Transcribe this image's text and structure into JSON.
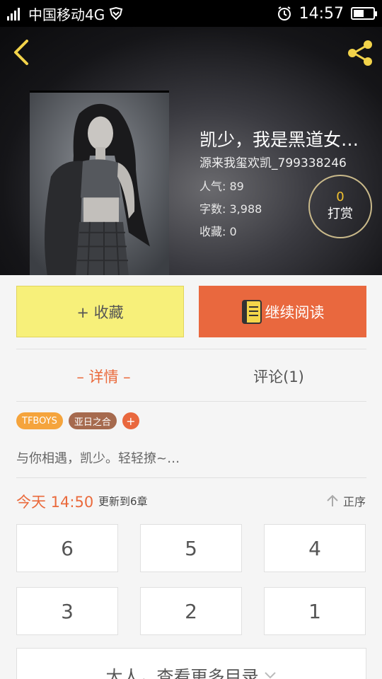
{
  "status_bar": {
    "network": "中国移动4G",
    "time": "14:57"
  },
  "book": {
    "title": "凯少，我是黑道女…",
    "author": "源来我玺欢凯_799338246",
    "popularity_label": "人气:",
    "popularity": "89",
    "word_count_label": "字数:",
    "word_count": "3,988",
    "favorites_label": "收藏:",
    "favorites": "0",
    "reward_count": "0",
    "reward_label": "打赏"
  },
  "actions": {
    "favorite_label": "+ 收藏",
    "continue_label": "继续阅读"
  },
  "tabs": {
    "details": "– 详情 –",
    "comments": "评论(1)"
  },
  "tags": [
    "TFBOYS",
    "亚日之合"
  ],
  "tag_add": "+",
  "summary": "与你相遇，凯少。轻轻撩~…",
  "update": {
    "time": "今天 14:50",
    "text": "更新到6章",
    "order_label": "正序"
  },
  "chapters": [
    "6",
    "5",
    "4",
    "3",
    "2",
    "1"
  ],
  "more_toc": "大人，查看更多目录",
  "colors": {
    "accent": "#e9683e",
    "favorite_bg": "#f7f07a",
    "tag1": "#f5a43c",
    "tag2": "#a66a4e"
  }
}
